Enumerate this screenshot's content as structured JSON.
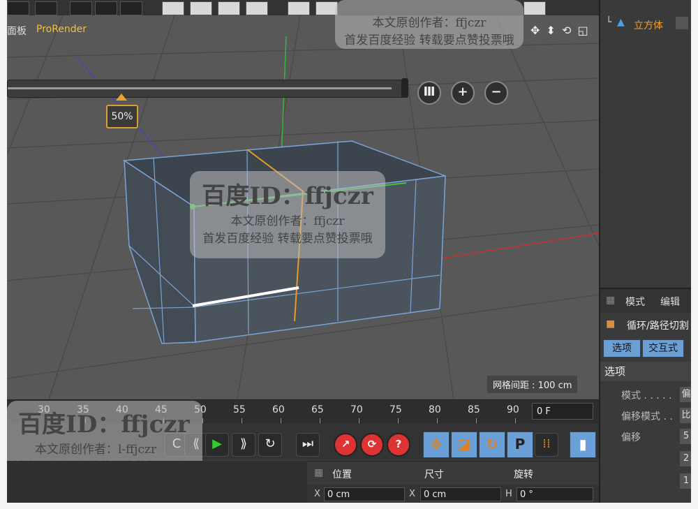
{
  "viewport": {
    "menu_left": "面板",
    "menu_renderer": "ProRender",
    "nav_icons": "✥ ⬍ ⟲ ◱",
    "grid_spacing": "网格间距 : 100 cm",
    "slider_percent": "50%",
    "slider_value": 0.5,
    "slider_buttons": [
      "Ⅲ",
      "+",
      "−"
    ]
  },
  "watermarks": {
    "top_line1": "本文原创作者：ffjczr",
    "top_line2": "首发百度经验 转载要点赞投票哦",
    "center_big": "百度ID：ffjczr",
    "center_line1": "本文原创作者：ffjczr",
    "center_line2": "首发百度经验 转载要点赞投票哦",
    "bottom_big": "百度ID：ffjczr",
    "bottom_line1": "本文原创作者：l-ffjczr",
    "bottom_line2": "首发百度经验 转载要点赞投票哦"
  },
  "timeline": {
    "ticks": [
      "30",
      "35",
      "40",
      "45",
      "50",
      "55",
      "60",
      "65",
      "70",
      "75",
      "80",
      "85",
      "90"
    ],
    "current_frame": "0 F"
  },
  "coords": {
    "headers": [
      "位置",
      "尺寸",
      "旋转"
    ],
    "x_label": "X",
    "x_pos": "0 cm",
    "x_size": "0 cm",
    "h_label": "H",
    "h_rot": "0 °"
  },
  "right_panel": {
    "object_name": "立方体",
    "tabs": [
      "模式",
      "编辑"
    ],
    "tool_name": "循环/路径切割",
    "buttons": [
      "选项",
      "交互式"
    ],
    "section": "选项",
    "props": [
      {
        "label": "模式 . . . . .",
        "value": "偏"
      },
      {
        "label": "偏移模式 . .",
        "value": "比"
      },
      {
        "label": "偏移",
        "value": "5"
      },
      {
        "label": "",
        "value": "2"
      },
      {
        "label": "",
        "value": "1"
      }
    ]
  },
  "colors": {
    "accent_orange": "#f0a030",
    "selection_blue": "#6c9fd4",
    "viewport_bg": "#585858"
  }
}
